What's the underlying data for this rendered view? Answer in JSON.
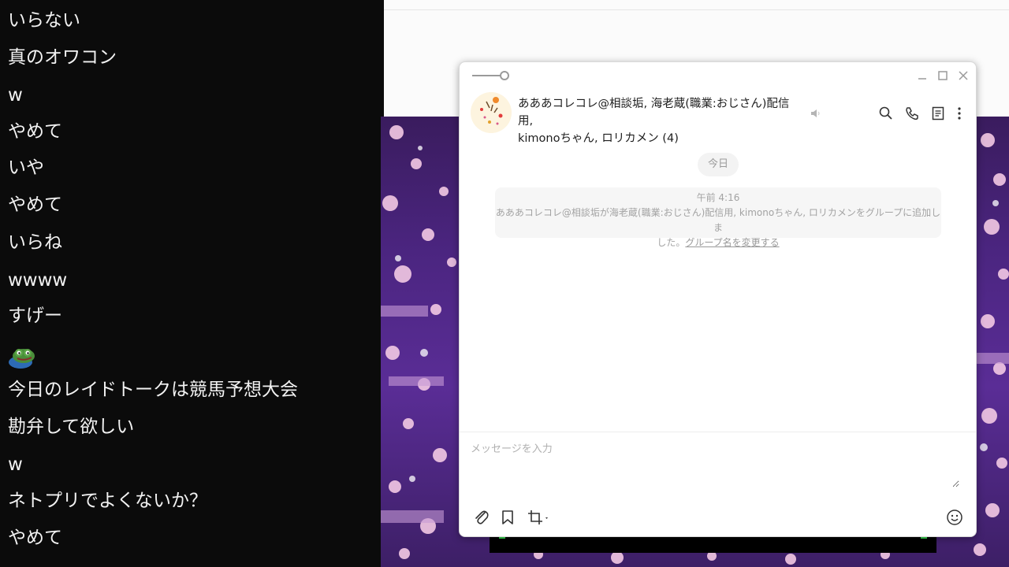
{
  "comments": [
    {
      "text": "いらない"
    },
    {
      "text": "真のオワコン"
    },
    {
      "text": "w"
    },
    {
      "text": "やめて"
    },
    {
      "text": "いや"
    },
    {
      "text": "やめて"
    },
    {
      "text": "いらね"
    },
    {
      "text": "wwww"
    },
    {
      "text": "すげー"
    },
    {
      "text": "今日のレイドトークは競馬予想大会"
    },
    {
      "text": "勘弁して欲しい"
    },
    {
      "text": "w"
    },
    {
      "text": "ネトプリでよくないか？"
    },
    {
      "text": "やめて"
    }
  ],
  "chat": {
    "title_line1": "あああコレコレ@相談垢, 海老蔵(職業:おじさん)配信用,",
    "title_line2": "kimonoちゃん, ロリカメン (4)",
    "date_label": "今日",
    "system_message": {
      "time": "午前 4:16",
      "text_line1": "あああコレコレ@相談垢が海老蔵(職業:おじさん)配信用, kimonoちゃん, ロリカメンをグループに追加しま",
      "text_line2": "した。",
      "link": "グループ名を変更する"
    },
    "input_placeholder": "メッセージを入力"
  },
  "icons": {
    "mute": "speaker-muted-icon",
    "search": "search-icon",
    "call": "phone-icon",
    "notes": "notes-icon",
    "more": "more-vertical-icon",
    "attach": "paperclip-icon",
    "bookmark": "bookmark-icon",
    "crop": "crop-icon",
    "emoji": "emoji-icon"
  },
  "colors": {
    "accent_green": "#3bdc52",
    "background_purple": "#4b2580"
  }
}
